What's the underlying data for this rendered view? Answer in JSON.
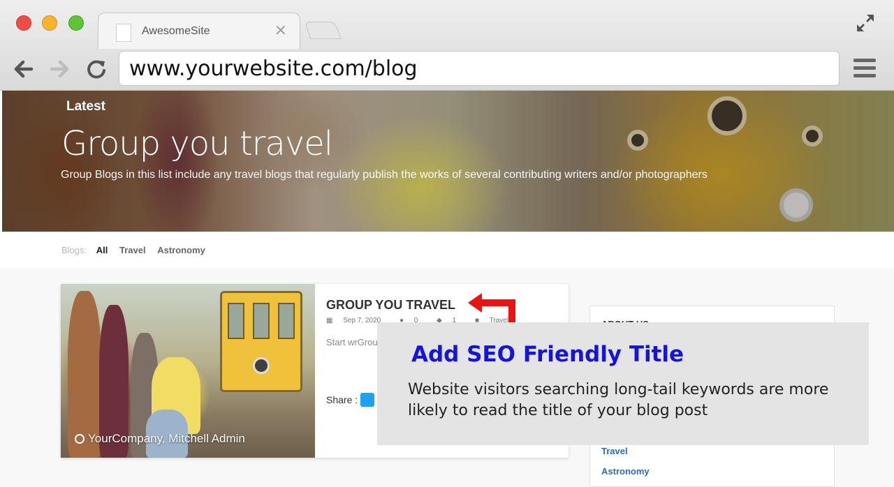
{
  "window": {
    "tab_title": "AwesomeSite",
    "tab_close": "×",
    "url": "www.yourwebsite.com/blog"
  },
  "hero": {
    "kicker": "Latest",
    "title": "Group you travel",
    "subtitle": "Group Blogs in this list include any travel blogs that regularly publish the works of several contributing writers and/or photographers"
  },
  "filters": {
    "label": "Blogs:",
    "items": [
      "All",
      "Travel",
      "Astronomy"
    ],
    "active": "All"
  },
  "post": {
    "title": "GROUP YOU TRAVEL",
    "date": "Sep 7, 2020",
    "comments": "0",
    "views": "1",
    "category": "Travel",
    "excerpt": "Start wrGroup blogs that re contributing",
    "share_label": "Share :",
    "image_caption": "YourCompany, Mitchell Admin"
  },
  "sidebar": {
    "heading": "ABOUT US",
    "links": [
      "Travel",
      "Astronomy"
    ]
  },
  "callout": {
    "title": "Add SEO Friendly Title",
    "body": "Website visitors searching long-tail keywords are more likely to read the title of your blog post"
  },
  "colors": {
    "callout_title": "#1414e0",
    "arrow": "#ee1111",
    "link": "#2a6ac3"
  },
  "icons": [
    "expand-icon",
    "back-icon",
    "forward-icon",
    "reload-icon",
    "menu-icon",
    "calendar-icon",
    "comment-icon",
    "views-icon",
    "folder-icon",
    "twitter-icon",
    "user-icon",
    "arrow-icon"
  ]
}
